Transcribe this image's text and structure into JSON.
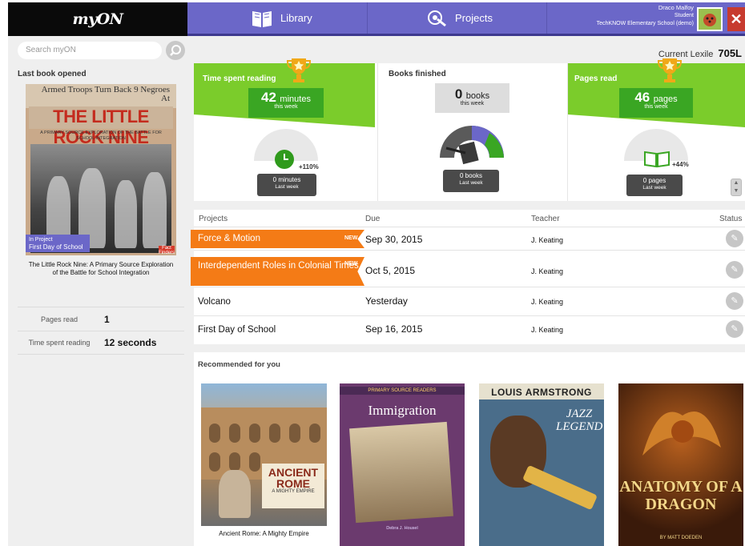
{
  "app": {
    "logo": "myON"
  },
  "nav": {
    "library_label": "Library",
    "projects_label": "Projects",
    "user": {
      "name": "Draco Malfoy",
      "role": "Student",
      "school": "TechKNOW Elementary School (demo)"
    }
  },
  "sidebar": {
    "search_placeholder": "Search myON",
    "last_book_title": "Last book opened",
    "book": {
      "cover_newspaper_text": "Armed Troops Turn Back 9 Negroes At",
      "cover_title": "THE LITTLE ROCK NINE",
      "cover_subtitle": "A PRIMARY SOURCE EXPLORATION OF THE BATTLE FOR SCHOOL INTEGRATION",
      "in_project_label": "In Project",
      "in_project_name": "First Day of School",
      "publisher_badge": "Fact Finders",
      "caption": "The Little Rock Nine: A Primary Source Exploration of the Battle for School Integration"
    },
    "stats": [
      {
        "label": "Pages read",
        "value": "1"
      },
      {
        "label": "Time spent reading",
        "value": "12 seconds"
      }
    ]
  },
  "lexile": {
    "label": "Current Lexile",
    "value": "705L"
  },
  "stats_panels": {
    "time": {
      "title": "Time spent reading",
      "value": "42",
      "unit": "minutes",
      "period": "this week",
      "last_value": "0 minutes",
      "last_period": "Last week",
      "change": "+110%"
    },
    "books": {
      "title": "Books finished",
      "value": "0",
      "unit": "books",
      "period": "this week",
      "last_value": "0 books",
      "last_period": "Last week"
    },
    "pages": {
      "title": "Pages read",
      "value": "46",
      "unit": "pages",
      "period": "this week",
      "last_value": "0 pages",
      "last_period": "Last week",
      "change": "+44%"
    }
  },
  "projects": {
    "headers": {
      "name": "Projects",
      "due": "Due",
      "teacher": "Teacher",
      "status": "Status"
    },
    "new_label": "NEW",
    "rows": [
      {
        "name": "Force & Motion",
        "due": "Sep 30, 2015",
        "teacher": "J. Keating",
        "is_new": true
      },
      {
        "name": "Interdependent Roles in Colonial Times",
        "due": "Oct 5, 2015",
        "teacher": "J. Keating",
        "is_new": true
      },
      {
        "name": "Volcano",
        "due": "Yesterday",
        "teacher": "J. Keating",
        "is_new": false
      },
      {
        "name": "First Day of School",
        "due": "Sep 16, 2015",
        "teacher": "J. Keating",
        "is_new": false
      }
    ]
  },
  "recommended": {
    "title": "Recommended for you",
    "books": [
      {
        "cover_title": "ANCIENT ROME",
        "cover_subtitle": "A MIGHTY EMPIRE",
        "caption": "Ancient Rome: A Mighty Empire"
      },
      {
        "cover_series": "PRIMARY SOURCE READERS",
        "cover_title": "Immigration",
        "cover_author": "Debra J. Housel"
      },
      {
        "cover_title": "LOUIS ARMSTRONG",
        "cover_subtitle": "JAZZ LEGEND"
      },
      {
        "cover_title": "ANATOMY OF A DRAGON",
        "cover_author": "BY MATT DOEDEN"
      }
    ]
  },
  "colors": {
    "nav_purple": "#6b67c8",
    "green": "#7bcc2b",
    "dark_green": "#3aa623",
    "orange": "#f47b16"
  }
}
